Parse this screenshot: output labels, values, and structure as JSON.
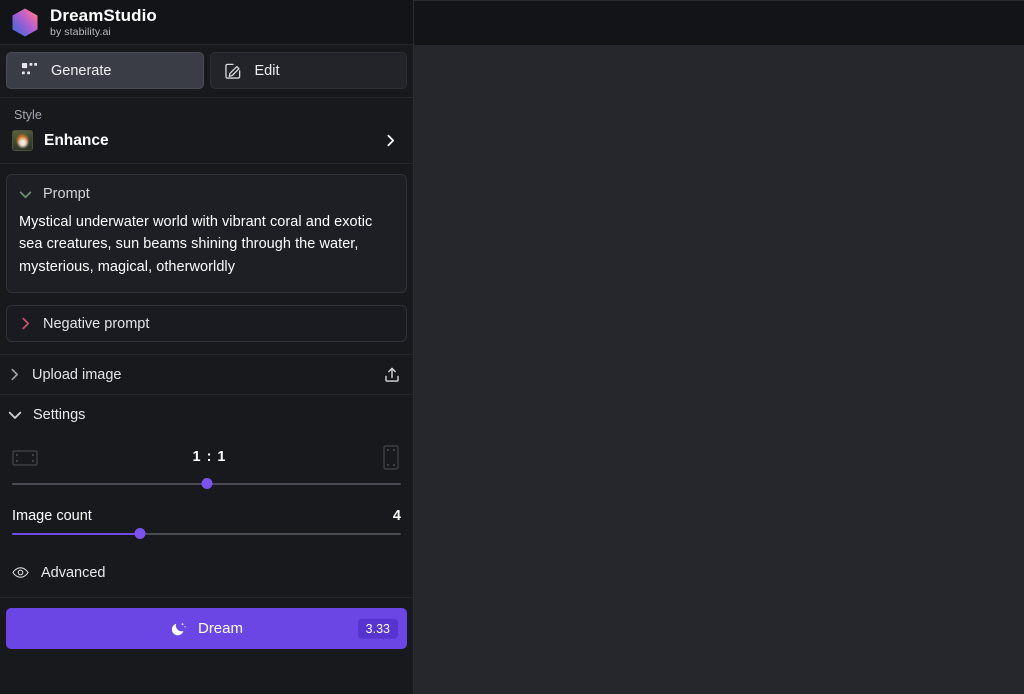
{
  "brand": {
    "title": "DreamStudio",
    "subtitle": "by stability.ai",
    "logo_icon": "hexagon-gradient-logo"
  },
  "tabs": [
    {
      "label": "Generate",
      "icon": "grid-squares-icon",
      "active": true
    },
    {
      "label": "Edit",
      "icon": "pencil-square-icon",
      "active": false
    }
  ],
  "style": {
    "caption": "Style",
    "value": "Enhance",
    "chevron_icon": "chevron-right-icon",
    "thumbnail_icon": "style-thumbnail"
  },
  "prompt": {
    "label": "Prompt",
    "chevron_icon": "chevron-down-icon",
    "text": "Mystical underwater world with vibrant coral and exotic sea creatures, sun beams shining through the water, mysterious, magical, otherworldly",
    "expanded": true
  },
  "negative_prompt": {
    "label": "Negative prompt",
    "chevron_icon": "chevron-right-icon",
    "expanded": false
  },
  "upload": {
    "label": "Upload image",
    "chevron_icon": "chevron-right-icon",
    "action_icon": "upload-icon"
  },
  "settings": {
    "label": "Settings",
    "chevron_icon": "chevron-down-icon",
    "aspect_ratio": {
      "value": "1 : 1",
      "left_icon": "landscape-ratio-icon",
      "right_icon": "portrait-ratio-icon",
      "slider_percent": 50
    },
    "image_count": {
      "label": "Image count",
      "value": "4",
      "slider_percent": 33
    },
    "advanced": {
      "label": "Advanced",
      "icon": "eye-icon"
    }
  },
  "dream": {
    "label": "Dream",
    "icon": "moon-stars-icon",
    "credits": "3.33"
  },
  "colors": {
    "accent_purple": "#6b46e5",
    "slider_thumb": "#7b52f0",
    "sidebar_bg": "#18191d",
    "canvas_bg": "#26272d",
    "header_bg": "#131418",
    "negative_chevron": "#c94f6d",
    "prompt_chevron": "#6e8f72"
  }
}
